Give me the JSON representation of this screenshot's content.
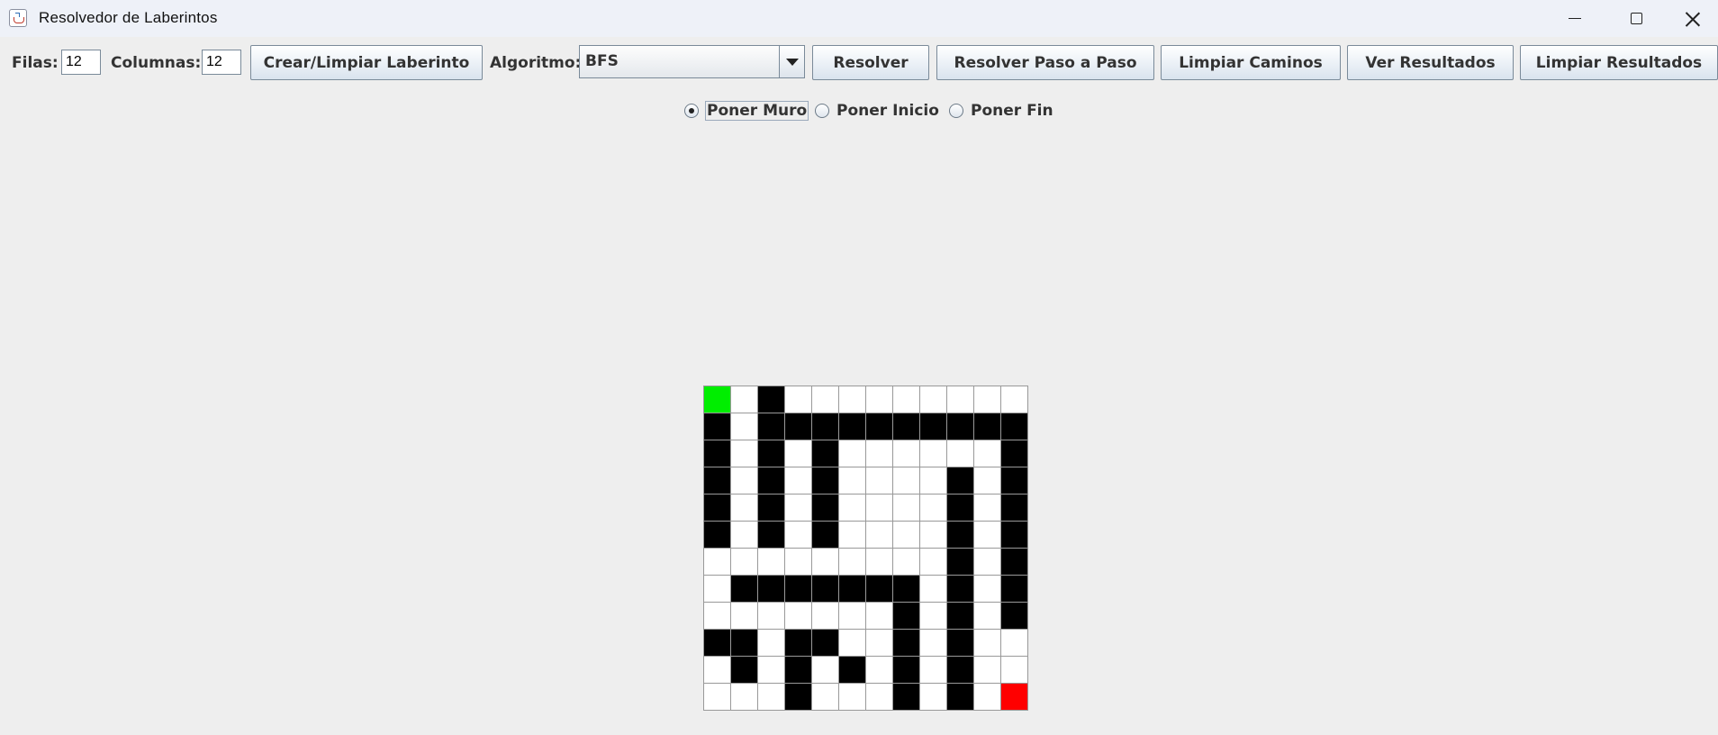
{
  "window": {
    "title": "Resolvedor de Laberintos",
    "controls": [
      "minimize-icon",
      "maximize-icon",
      "close-icon"
    ]
  },
  "toolbar": {
    "filas_label": "Filas:",
    "filas_value": "12",
    "columnas_label": "Columnas:",
    "columnas_value": "12",
    "crear_button": "Crear/Limpiar Laberinto",
    "algoritmo_label": "Algoritmo:",
    "algoritmo_value": "BFS",
    "resolver_button": "Resolver",
    "paso_button": "Resolver Paso a Paso",
    "limpiar_caminos_button": "Limpiar Caminos",
    "ver_resultados_button": "Ver Resultados",
    "limpiar_resultados_button": "Limpiar Resultados"
  },
  "modes": {
    "selected": "wall",
    "wall_label": "Poner Muro",
    "start_label": "Poner Inicio",
    "end_label": "Poner Fin"
  },
  "maze": {
    "rows": 12,
    "cols": 12,
    "colors": {
      "wall": "#000000",
      "empty": "#ffffff",
      "start": "#00ee00",
      "end": "#ff0000"
    },
    "grid": [
      "S.#.........",
      "#.##########",
      "#.#.#......#",
      "#.#.#....#.#",
      "#.#.#....#.#",
      "#.#.#....#.#",
      ".........#.#",
      ".#######.#.#",
      ".......#.#.#",
      "##.##..#.#..",
      ".#.#.#.#.#..",
      "...#...#.#.E"
    ]
  }
}
